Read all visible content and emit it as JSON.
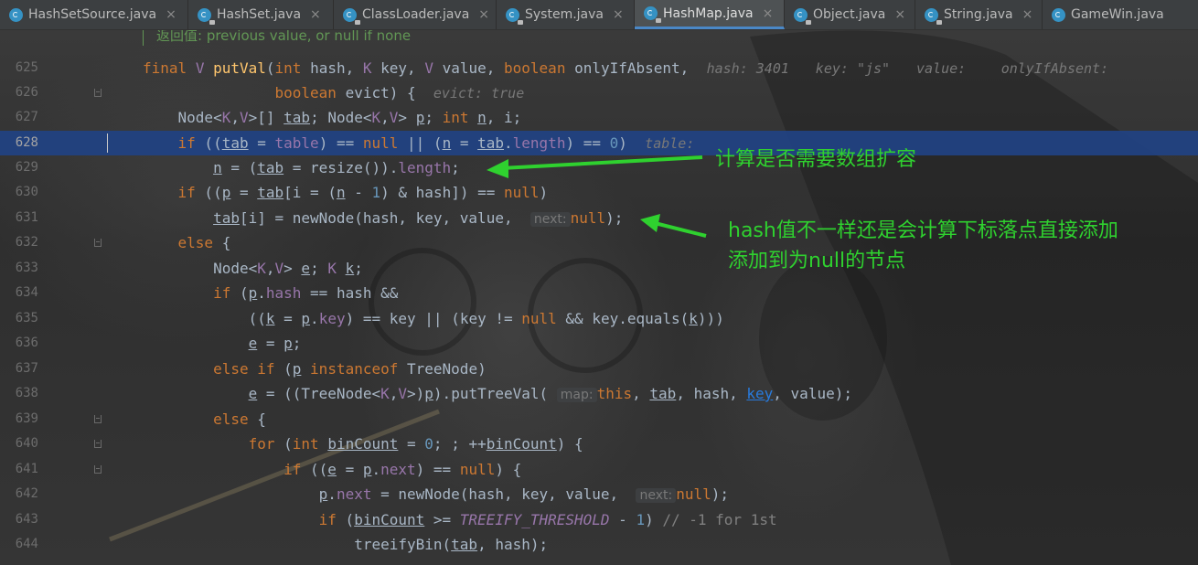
{
  "tabs": [
    {
      "label": "HashSetSource.java",
      "close": "×"
    },
    {
      "label": "HashSet.java",
      "close": "×"
    },
    {
      "label": "ClassLoader.java",
      "close": "×"
    },
    {
      "label": "System.java",
      "close": "×"
    },
    {
      "label": "HashMap.java",
      "close": "×",
      "active": true
    },
    {
      "label": "Object.java",
      "close": "×"
    },
    {
      "label": "String.java",
      "close": "×"
    },
    {
      "label": "GameWin.java",
      "close": ""
    }
  ],
  "doc_comment": "返回值: previous value, or null if none",
  "line_numbers": [
    "625",
    "626",
    "627",
    "628",
    "629",
    "630",
    "631",
    "632",
    "633",
    "634",
    "635",
    "636",
    "637",
    "638",
    "639",
    "640",
    "641",
    "642",
    "643",
    "644"
  ],
  "current_line": "628",
  "debug_values": {
    "hash": "hash: 3401",
    "key": "key: \"js\"",
    "value": "value:",
    "only_if_absent": "onlyIfAbsent:",
    "evict": "evict: true",
    "table": "table:"
  },
  "param_hints": {
    "next_1": "next:",
    "map": "map:",
    "next_2": "next:"
  },
  "comment_1st": "// -1 for 1st",
  "annotations": {
    "resize_note": "计算是否需要数组扩容",
    "hash_note": "hash值不一样还是会计算下标落点直接添加\n添加到为null的节点"
  },
  "colors": {
    "editor_bg": "#2b2b2b",
    "highlight_line": "#214283",
    "annotation_green": "#2fd12f",
    "keyword": "#cc7832",
    "method": "#ffc66d",
    "number": "#6897bb",
    "field": "#9876aa"
  }
}
